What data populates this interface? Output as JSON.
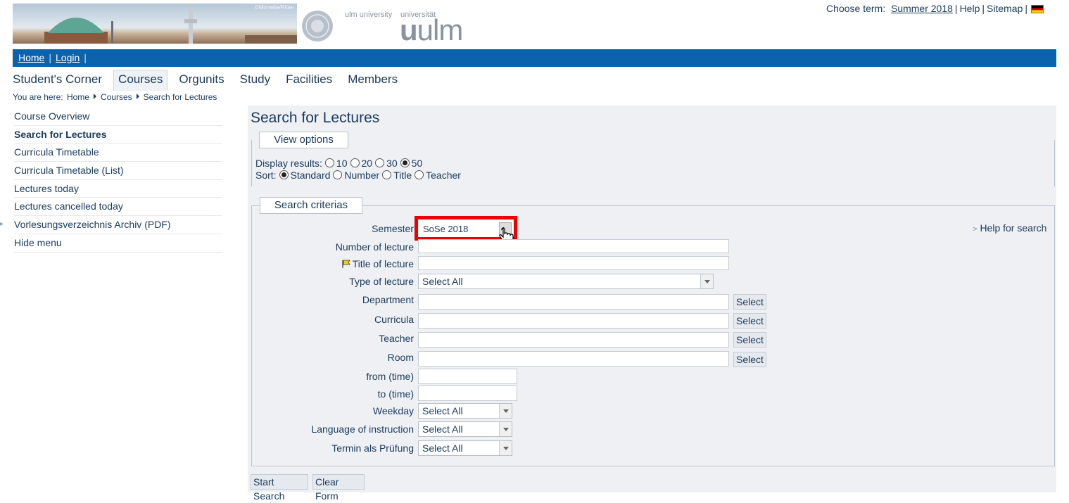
{
  "header": {
    "banner_copyright": "©Monette/Ritter",
    "university_small_en": "ulm university",
    "university_small_de": "universität",
    "logo_text_a": "u",
    "logo_text_b": "ulm",
    "choose_term_label": "Choose term:",
    "term_value": "Summer 2018",
    "help_link": "Help",
    "sitemap_link": "Sitemap"
  },
  "bluebar": {
    "home": "Home",
    "login": "Login",
    "pipe": "|"
  },
  "mainnav": {
    "items": [
      "Student's Corner",
      "Courses",
      "Orgunits",
      "Study",
      "Facilities",
      "Members"
    ],
    "active": "Courses"
  },
  "breadcrumb": {
    "prefix": "You are here:",
    "items": [
      "Home",
      "Courses",
      "Search for Lectures"
    ]
  },
  "sidebar": {
    "items": [
      "Course Overview",
      "Search for Lectures",
      "Curricula Timetable",
      "Curricula Timetable (List)",
      "Lectures today",
      "Lectures cancelled today",
      "Vorlesungsverzeichnis Archiv (PDF)",
      "Hide menu"
    ],
    "active": "Search for Lectures",
    "bullet": "▸"
  },
  "page": {
    "title": "Search for Lectures",
    "view_options_label": "View options",
    "display_results_label": "Display results:",
    "display_options": [
      "10",
      "20",
      "30",
      "50"
    ],
    "display_selected": "50",
    "sort_label": "Sort:",
    "sort_options": [
      "Standard",
      "Number",
      "Title",
      "Teacher"
    ],
    "sort_selected": "Standard",
    "criteria_label": "Search criterias",
    "help_for_search": "Help for search",
    "help_gt": ">"
  },
  "form": {
    "semester_label": "Semester",
    "semester_value": "SoSe 2018",
    "number_label": "Number of lecture",
    "title_label": "Title of lecture",
    "type_label": "Type of lecture",
    "type_value": "Select All",
    "department_label": "Department",
    "curricula_label": "Curricula",
    "teacher_label": "Teacher",
    "room_label": "Room",
    "select_button": "Select",
    "from_label": "from (time)",
    "to_label": "to (time)",
    "weekday_label": "Weekday",
    "weekday_value": "Select All",
    "language_label": "Language of instruction",
    "language_value": "Select All",
    "termin_label": "Termin als Prüfung",
    "termin_value": "Select All",
    "start_search": "Start Search",
    "clear_form": "Clear Form"
  },
  "colors": {
    "brand_blue": "#0b62ad",
    "highlight_red": "#e00000",
    "panel_bg": "#eef0f4"
  }
}
